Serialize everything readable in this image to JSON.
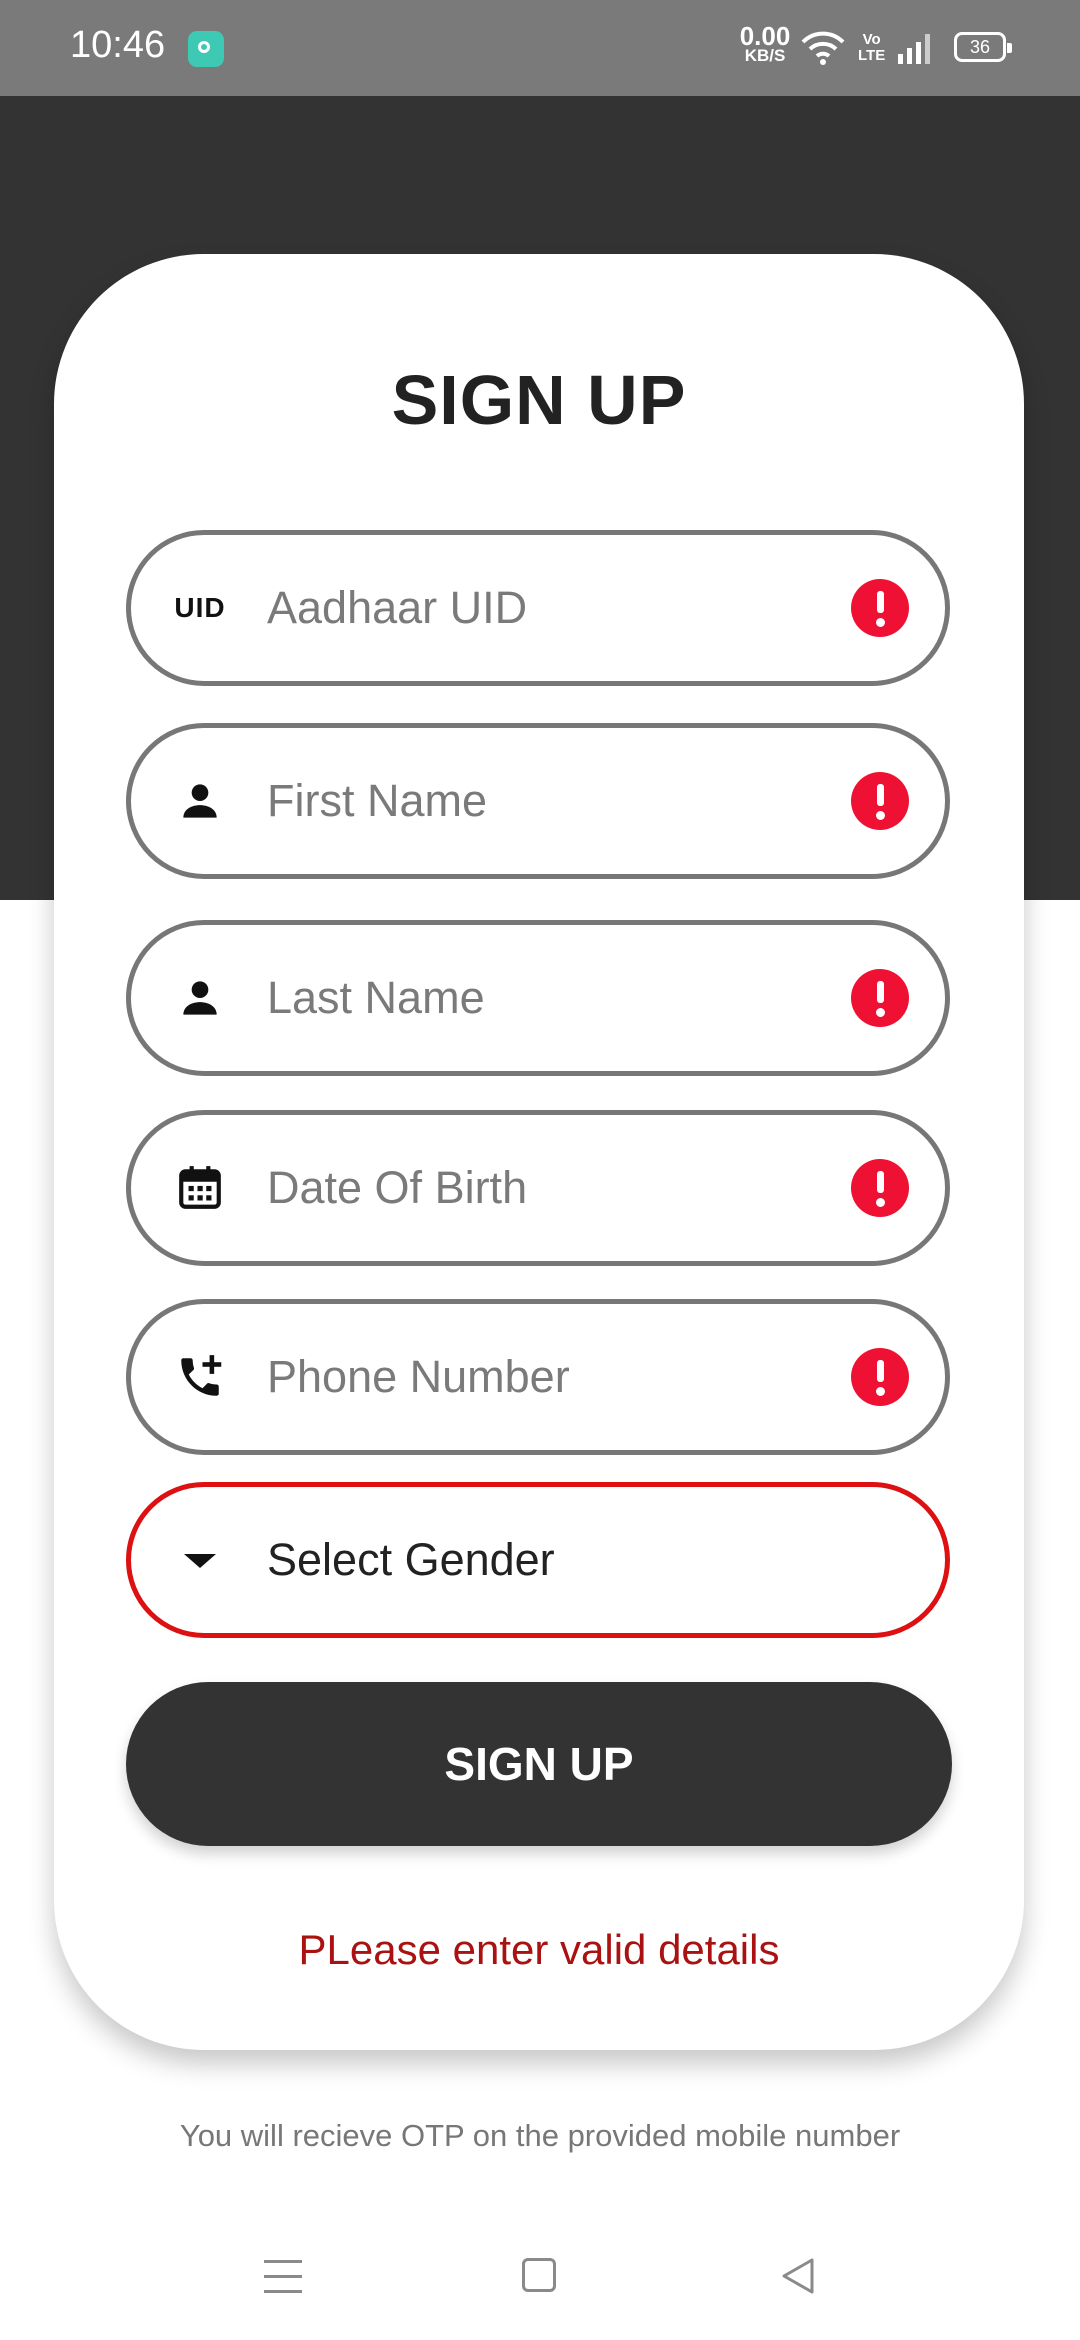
{
  "status_bar": {
    "time": "10:46",
    "net_speed_value": "0.00",
    "net_speed_unit": "KB/S",
    "volte_top": "Vo",
    "volte_bottom": "LTE",
    "battery": "36"
  },
  "form": {
    "title": "SIGN UP",
    "uid_icon_text": "UID",
    "fields": [
      {
        "placeholder": "Aadhaar UID",
        "icon": "uid-icon",
        "error": true
      },
      {
        "placeholder": "First Name",
        "icon": "person-icon",
        "error": true
      },
      {
        "placeholder": "Last Name",
        "icon": "person-icon",
        "error": true
      },
      {
        "placeholder": "Date Of Birth",
        "icon": "calendar-icon",
        "error": true
      },
      {
        "placeholder": "Phone Number",
        "icon": "phone-add-icon",
        "error": true
      }
    ],
    "gender_select": {
      "value": "Select Gender",
      "icon": "dropdown-arrow-icon"
    },
    "submit_label": "SIGN UP",
    "error_message": "PLease enter valid details"
  },
  "otp_note": "You will recieve OTP on the provided mobile number",
  "colors": {
    "dark": "#333333",
    "error": "#ee1133",
    "error_text": "#aa1111",
    "field_border": "#777777",
    "select_border_error": "#dd1111"
  }
}
